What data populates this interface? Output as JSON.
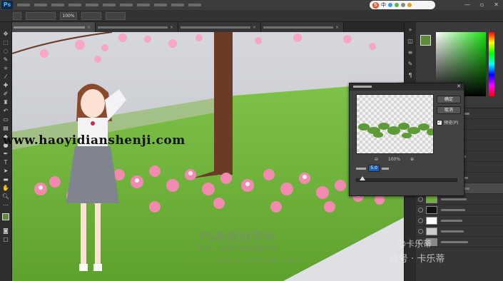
{
  "app": {
    "logo": "Ps"
  },
  "ime": {
    "label": "中",
    "logo": "S"
  },
  "window_controls": {
    "minimize": "—",
    "maximize": "▫",
    "close": "✕"
  },
  "options_bar": {
    "opacity_value": "100%"
  },
  "dialog": {
    "zoom_value": "100%",
    "radius_value": "5.0",
    "ok_label": "确定",
    "cancel_label": "取消",
    "preview_label": "预览(P)"
  },
  "watermarks": {
    "url": "www.haoyidianshenji.com",
    "ps_title": "PS教程自学网",
    "ps_sub": "学PS，就到PS教程自学网",
    "ps_url": "www.16xx8.com",
    "weibo": "@卡乐蒂",
    "gongzhonghao": "众号 · 卡乐蒂"
  },
  "colors": {
    "foreground": "#5f8a3b",
    "background": "#ffffff",
    "grass": "#6fb13a",
    "blossom": "#f28ab0",
    "trunk": "#6b3b26"
  }
}
